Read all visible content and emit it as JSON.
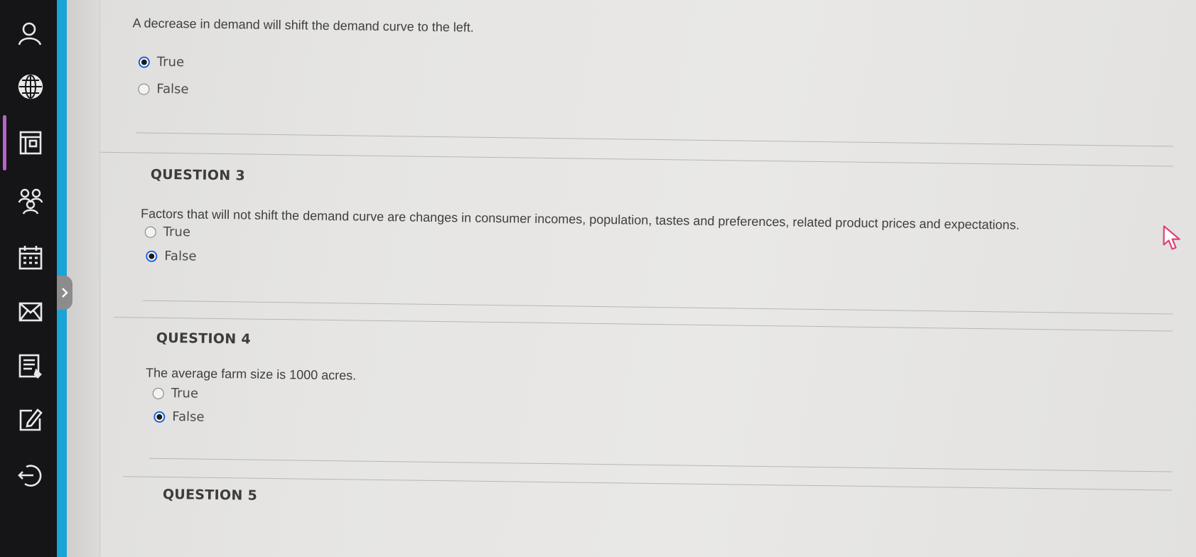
{
  "sidebar": {
    "icons": [
      "user-icon",
      "globe-icon",
      "courses-icon",
      "groups-icon",
      "calendar-icon",
      "mail-icon",
      "grades-icon",
      "edit-icon",
      "sign-out-icon"
    ],
    "collapse_icon": "chevron-right-icon",
    "accent_color": "#1aa3d6",
    "active_indicator_color": "#b565c7"
  },
  "questions": [
    {
      "number": "",
      "text": "A decrease in demand will shift the demand curve to the left.",
      "options": [
        {
          "label": "True",
          "selected": true
        },
        {
          "label": "False",
          "selected": false
        }
      ]
    },
    {
      "number": "QUESTION 3",
      "text": "Factors that will not shift the demand curve are changes in consumer incomes, population, tastes and preferences, related product prices and expectations.",
      "options": [
        {
          "label": "True",
          "selected": false
        },
        {
          "label": "False",
          "selected": true
        }
      ]
    },
    {
      "number": "QUESTION 4",
      "text": "The average farm size is 1000 acres.",
      "options": [
        {
          "label": "True",
          "selected": false
        },
        {
          "label": "False",
          "selected": true
        }
      ]
    },
    {
      "number": "QUESTION 5",
      "text": "",
      "options": []
    }
  ],
  "colors": {
    "radio_selected_ring": "#1e5fd6",
    "text": "#3e3e40"
  }
}
